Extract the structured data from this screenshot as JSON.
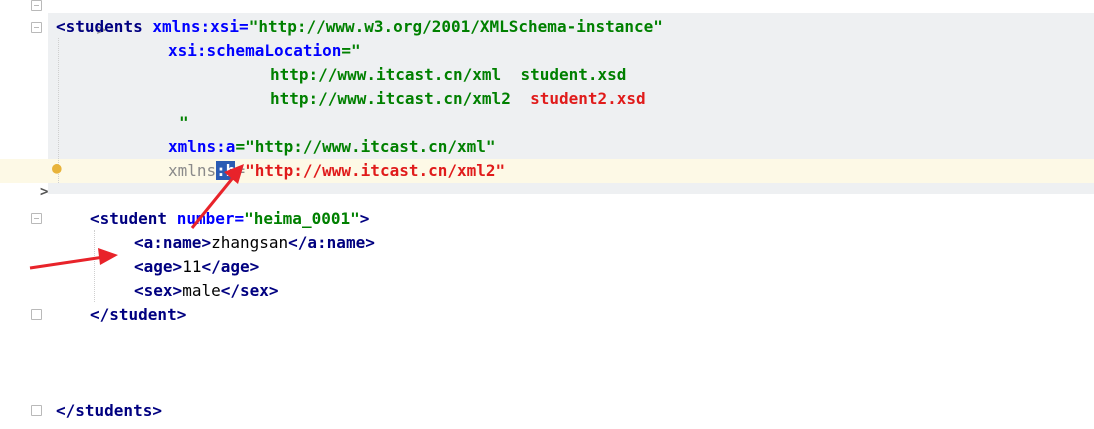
{
  "comment_end": "-->",
  "root": {
    "open_tag": "students",
    "attrs": {
      "xsi_name": "xmlns:xsi",
      "xsi_value": "\"http://www.w3.org/2001/XMLSchema-instance\"",
      "schema_location_name": "xsi:schemaLocation",
      "schema_location_open": "=\"",
      "schema_line1_ns": "http://www.itcast.cn/xml",
      "schema_line1_xsd": "student.xsd",
      "schema_line2_ns": "http://www.itcast.cn/xml2",
      "schema_line2_xsd": "student2.xsd",
      "schema_location_close": "\"",
      "ns_a_prefix": "xmlns:",
      "ns_a_letter": "a",
      "ns_a_value": "=\"http://www.itcast.cn/xml\"",
      "ns_b_prefix": "xmlns",
      "ns_b_selected": ":b",
      "ns_b_value": "\"http://www.itcast.cn/xml2\""
    },
    "close_bracket": ">",
    "close_tag": "</students>"
  },
  "student": {
    "open_tag": "<student",
    "attr_name": "number",
    "attr_value": "\"heima_0001\"",
    "children": [
      {
        "tag": "a:name",
        "text": "zhangsan"
      },
      {
        "tag": "age",
        "text": "11"
      },
      {
        "tag": "sex",
        "text": "male"
      }
    ],
    "close_tag": "</student>"
  },
  "colors": {
    "tag": "#000080",
    "attribute": "#0000ff",
    "string": "#008000",
    "highlight_red": "#e01b1b",
    "selection": "#2b5cb3",
    "annotation_arrow": "#e8232a"
  },
  "icons": {
    "bulb": "lightbulb-icon",
    "fold": "fold-marker-icon",
    "chevron": "chevron-right-icon"
  }
}
